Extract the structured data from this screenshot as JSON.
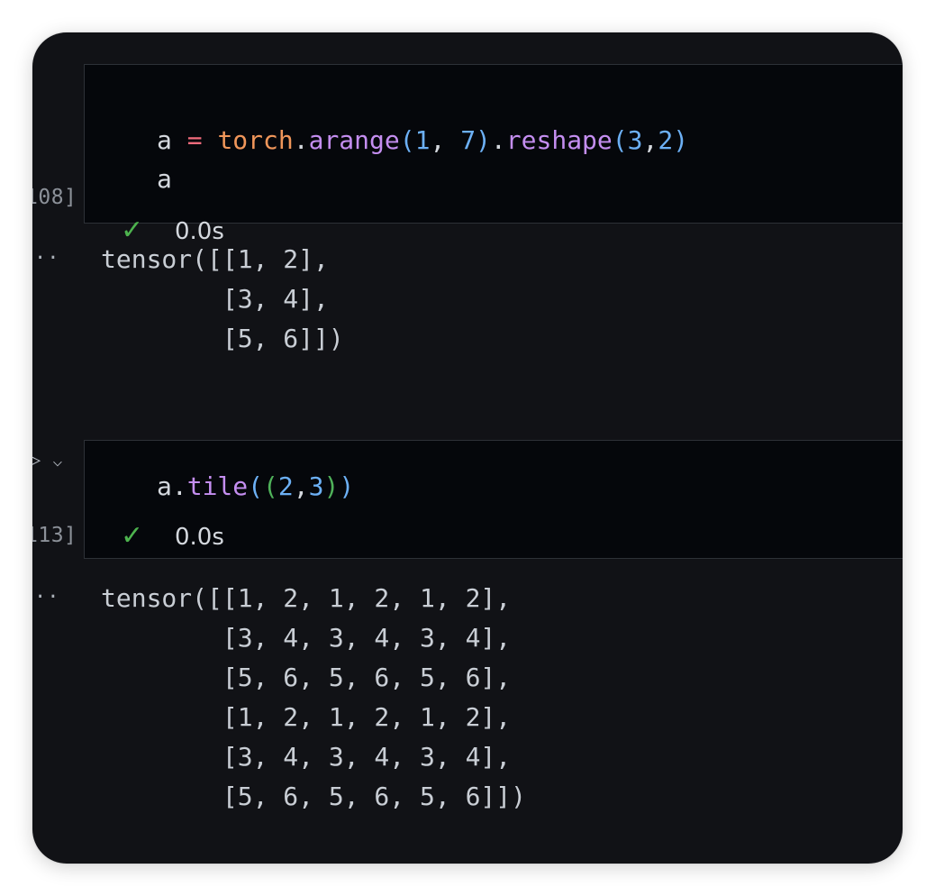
{
  "cells": [
    {
      "exec_count": "108]",
      "code_line1": {
        "var": "a",
        "op": "=",
        "module": "torch",
        "dot1": ".",
        "fn1": "arange",
        "lparen1": "(",
        "arg1": "1",
        "comma1": ",",
        "arg2": "7",
        "rparen1": ")",
        "dot2": ".",
        "fn2": "reshape",
        "lparen2": "(",
        "arg3": "3",
        "comma2": ",",
        "arg4": "2",
        "rparen2": ")"
      },
      "code_line2": "a",
      "status_icon": "check-icon",
      "status_text": "0.0s",
      "output_marker": "··",
      "output_lines": [
        "tensor([[1, 2],",
        "        [3, 4],",
        "        [5, 6]])"
      ]
    },
    {
      "exec_count": "113]",
      "run_icons": [
        "run-icon",
        "chevron-down-icon"
      ],
      "code_line1": {
        "var": "a",
        "dot": ".",
        "fn": "tile",
        "lparen_outer": "(",
        "lparen_inner": "(",
        "arg1": "2",
        "comma": ",",
        "arg2": "3",
        "rparen_inner": ")",
        "rparen_outer": ")"
      },
      "status_icon": "check-icon",
      "status_text": "0.0s",
      "output_marker": "··",
      "output_lines": [
        "tensor([[1, 2, 1, 2, 1, 2],",
        "        [3, 4, 3, 4, 3, 4],",
        "        [5, 6, 5, 6, 5, 6],",
        "        [1, 2, 1, 2, 1, 2],",
        "        [3, 4, 3, 4, 3, 4],",
        "        [5, 6, 5, 6, 5, 6]])"
      ]
    }
  ],
  "colors": {
    "background": "#111216",
    "cell_background": "#05070b",
    "keyword_operator": "#f36b7c",
    "module": "#f0965a",
    "function": "#c48ef0",
    "number": "#6cb0f5",
    "check": "#4db34e"
  }
}
